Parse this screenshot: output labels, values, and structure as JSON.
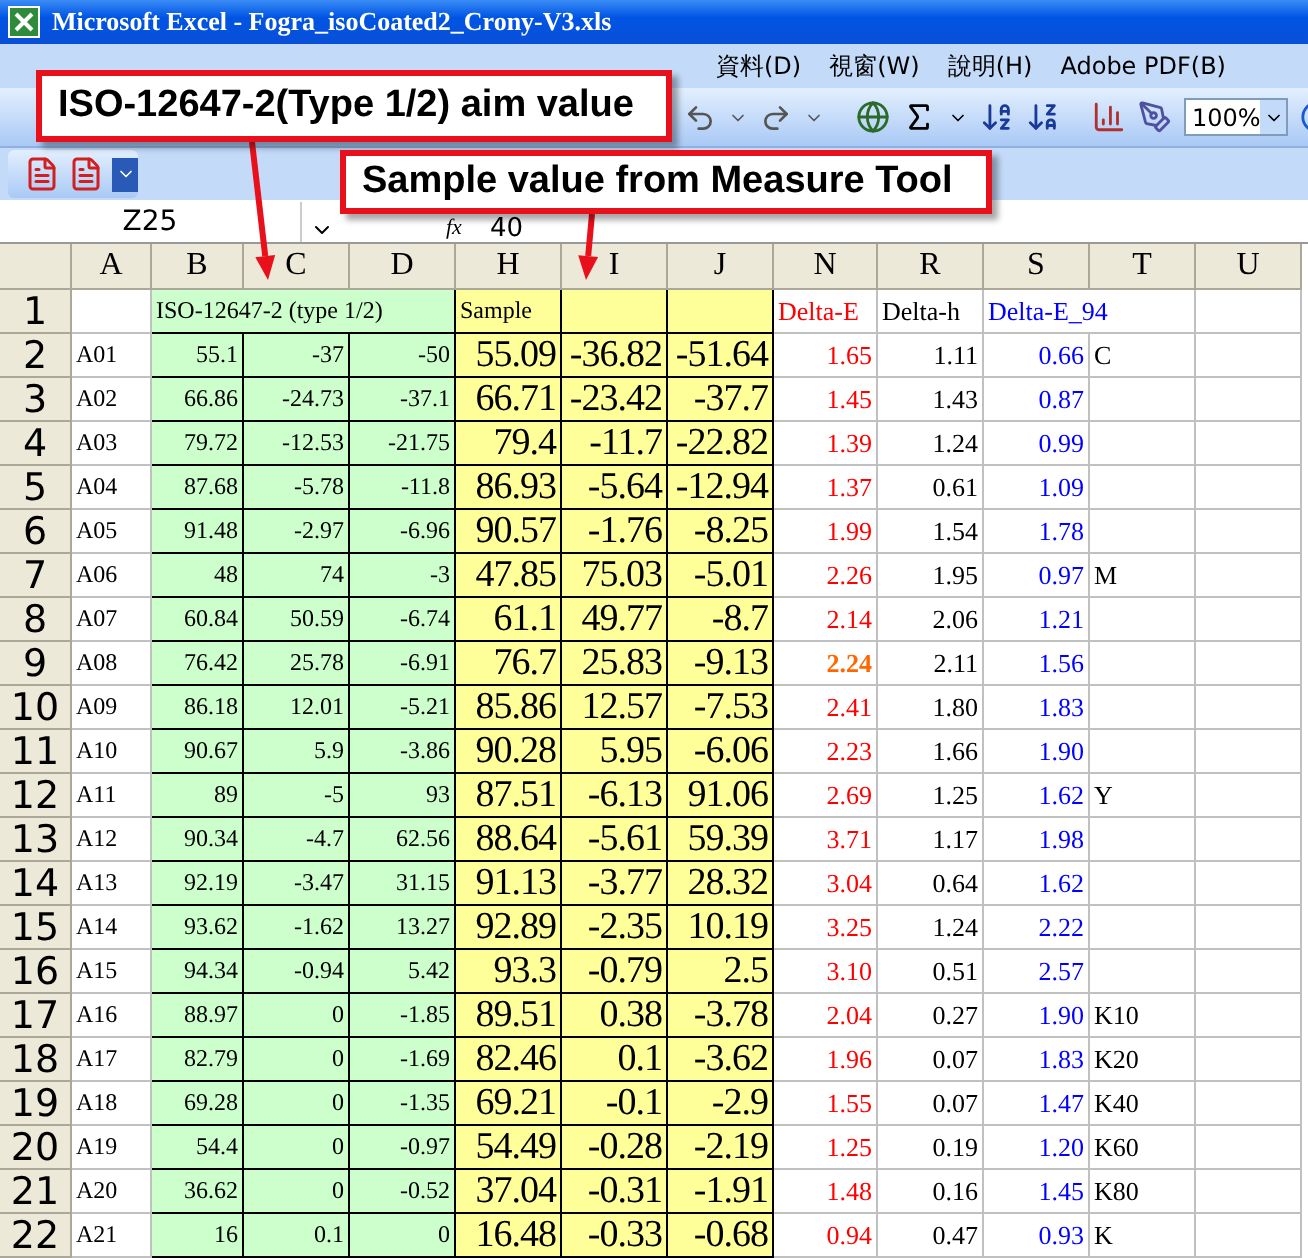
{
  "window": {
    "title": "Microsoft Excel - Fogra_isoCoated2_Crony-V3.xls"
  },
  "menu": [
    "資料(D)",
    "視窗(W)",
    "說明(H)",
    "Adobe PDF(B)"
  ],
  "toolbar": {
    "zoom": "100%"
  },
  "formula_bar": {
    "name_box": "Z25",
    "fx_label": "fx",
    "formula": "40"
  },
  "columns": [
    "A",
    "B",
    "C",
    "D",
    "H",
    "I",
    "J",
    "N",
    "R",
    "S",
    "T",
    "U"
  ],
  "header_row": {
    "number": "1",
    "aim_label": "ISO-12647-2 (type 1/2)",
    "sample_label": "Sample",
    "delta_e_label": "Delta-E",
    "delta_h_label": "Delta-h",
    "delta_e94_label": "Delta-E_94"
  },
  "rows": [
    {
      "number": "2",
      "patch": "A01",
      "aim": [
        "55.1",
        "-37",
        "-50"
      ],
      "sample": [
        "55.09",
        "-36.82",
        "-51.64"
      ],
      "delta_e": "1.65",
      "highlighted": false,
      "delta_h": "1.11",
      "delta_e94": "0.66",
      "note": "C"
    },
    {
      "number": "3",
      "patch": "A02",
      "aim": [
        "66.86",
        "-24.73",
        "-37.1"
      ],
      "sample": [
        "66.71",
        "-23.42",
        "-37.7"
      ],
      "delta_e": "1.45",
      "highlighted": false,
      "delta_h": "1.43",
      "delta_e94": "0.87"
    },
    {
      "number": "4",
      "patch": "A03",
      "aim": [
        "79.72",
        "-12.53",
        "-21.75"
      ],
      "sample": [
        "79.4",
        "-11.7",
        "-22.82"
      ],
      "delta_e": "1.39",
      "highlighted": false,
      "delta_h": "1.24",
      "delta_e94": "0.99"
    },
    {
      "number": "5",
      "patch": "A04",
      "aim": [
        "87.68",
        "-5.78",
        "-11.8"
      ],
      "sample": [
        "86.93",
        "-5.64",
        "-12.94"
      ],
      "delta_e": "1.37",
      "highlighted": false,
      "delta_h": "0.61",
      "delta_e94": "1.09"
    },
    {
      "number": "6",
      "patch": "A05",
      "aim": [
        "91.48",
        "-2.97",
        "-6.96"
      ],
      "sample": [
        "90.57",
        "-1.76",
        "-8.25"
      ],
      "delta_e": "1.99",
      "highlighted": false,
      "delta_h": "1.54",
      "delta_e94": "1.78"
    },
    {
      "number": "7",
      "patch": "A06",
      "aim": [
        "48",
        "74",
        "-3"
      ],
      "sample": [
        "47.85",
        "75.03",
        "-5.01"
      ],
      "delta_e": "2.26",
      "highlighted": false,
      "delta_h": "1.95",
      "delta_e94": "0.97",
      "note": "M"
    },
    {
      "number": "8",
      "patch": "A07",
      "aim": [
        "60.84",
        "50.59",
        "-6.74"
      ],
      "sample": [
        "61.1",
        "49.77",
        "-8.7"
      ],
      "delta_e": "2.14",
      "highlighted": false,
      "delta_h": "2.06",
      "delta_e94": "1.21"
    },
    {
      "number": "9",
      "patch": "A08",
      "aim": [
        "76.42",
        "25.78",
        "-6.91"
      ],
      "sample": [
        "76.7",
        "25.83",
        "-9.13"
      ],
      "delta_e": "2.24",
      "highlighted": true,
      "delta_h": "2.11",
      "delta_e94": "1.56"
    },
    {
      "number": "10",
      "patch": "A09",
      "aim": [
        "86.18",
        "12.01",
        "-5.21"
      ],
      "sample": [
        "85.86",
        "12.57",
        "-7.53"
      ],
      "delta_e": "2.41",
      "highlighted": false,
      "delta_h": "1.80",
      "delta_e94": "1.83"
    },
    {
      "number": "11",
      "patch": "A10",
      "aim": [
        "90.67",
        "5.9",
        "-3.86"
      ],
      "sample": [
        "90.28",
        "5.95",
        "-6.06"
      ],
      "delta_e": "2.23",
      "highlighted": false,
      "delta_h": "1.66",
      "delta_e94": "1.90"
    },
    {
      "number": "12",
      "patch": "A11",
      "aim": [
        "89",
        "-5",
        "93"
      ],
      "sample": [
        "87.51",
        "-6.13",
        "91.06"
      ],
      "delta_e": "2.69",
      "highlighted": false,
      "delta_h": "1.25",
      "delta_e94": "1.62",
      "note": "Y"
    },
    {
      "number": "13",
      "patch": "A12",
      "aim": [
        "90.34",
        "-4.7",
        "62.56"
      ],
      "sample": [
        "88.64",
        "-5.61",
        "59.39"
      ],
      "delta_e": "3.71",
      "highlighted": false,
      "delta_h": "1.17",
      "delta_e94": "1.98"
    },
    {
      "number": "14",
      "patch": "A13",
      "aim": [
        "92.19",
        "-3.47",
        "31.15"
      ],
      "sample": [
        "91.13",
        "-3.77",
        "28.32"
      ],
      "delta_e": "3.04",
      "highlighted": false,
      "delta_h": "0.64",
      "delta_e94": "1.62"
    },
    {
      "number": "15",
      "patch": "A14",
      "aim": [
        "93.62",
        "-1.62",
        "13.27"
      ],
      "sample": [
        "92.89",
        "-2.35",
        "10.19"
      ],
      "delta_e": "3.25",
      "highlighted": false,
      "delta_h": "1.24",
      "delta_e94": "2.22"
    },
    {
      "number": "16",
      "patch": "A15",
      "aim": [
        "94.34",
        "-0.94",
        "5.42"
      ],
      "sample": [
        "93.3",
        "-0.79",
        "2.5"
      ],
      "delta_e": "3.10",
      "highlighted": false,
      "delta_h": "0.51",
      "delta_e94": "2.57"
    },
    {
      "number": "17",
      "patch": "A16",
      "aim": [
        "88.97",
        "0",
        "-1.85"
      ],
      "sample": [
        "89.51",
        "0.38",
        "-3.78"
      ],
      "delta_e": "2.04",
      "highlighted": false,
      "delta_h": "0.27",
      "delta_e94": "1.90",
      "note": "K10"
    },
    {
      "number": "18",
      "patch": "A17",
      "aim": [
        "82.79",
        "0",
        "-1.69"
      ],
      "sample": [
        "82.46",
        "0.1",
        "-3.62"
      ],
      "delta_e": "1.96",
      "highlighted": false,
      "delta_h": "0.07",
      "delta_e94": "1.83",
      "note": "K20"
    },
    {
      "number": "19",
      "patch": "A18",
      "aim": [
        "69.28",
        "0",
        "-1.35"
      ],
      "sample": [
        "69.21",
        "-0.1",
        "-2.9"
      ],
      "delta_e": "1.55",
      "highlighted": false,
      "delta_h": "0.07",
      "delta_e94": "1.47",
      "note": "K40"
    },
    {
      "number": "20",
      "patch": "A19",
      "aim": [
        "54.4",
        "0",
        "-0.97"
      ],
      "sample": [
        "54.49",
        "-0.28",
        "-2.19"
      ],
      "delta_e": "1.25",
      "highlighted": false,
      "delta_h": "0.19",
      "delta_e94": "1.20",
      "note": "K60"
    },
    {
      "number": "21",
      "patch": "A20",
      "aim": [
        "36.62",
        "0",
        "-0.52"
      ],
      "sample": [
        "37.04",
        "-0.31",
        "-1.91"
      ],
      "delta_e": "1.48",
      "highlighted": false,
      "delta_h": "0.16",
      "delta_e94": "1.45",
      "note": "K80"
    },
    {
      "number": "22",
      "patch": "A21",
      "aim": [
        "16",
        "0.1",
        "0"
      ],
      "sample": [
        "16.48",
        "-0.33",
        "-0.68"
      ],
      "delta_e": "0.94",
      "highlighted": false,
      "delta_h": "0.47",
      "delta_e94": "0.93",
      "note": "K"
    }
  ],
  "callouts": [
    {
      "text": "ISO-12647-2(Type 1/2) aim value"
    },
    {
      "text": "Sample value from Measure Tool"
    }
  ]
}
